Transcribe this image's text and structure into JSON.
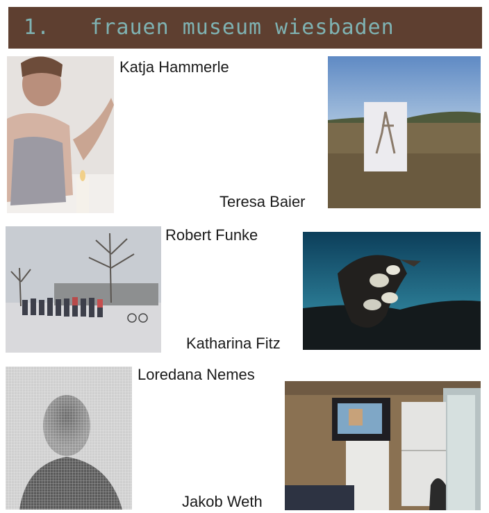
{
  "header": {
    "number": "1.",
    "title": "frauen museum wiesbaden",
    "color": "#5e3f30",
    "text_color": "#7fb3b3"
  },
  "artists": [
    {
      "name": "Katja Hammerle"
    },
    {
      "name": "Teresa Baier"
    },
    {
      "name": "Robert Funke"
    },
    {
      "name": "Katharina Fitz"
    },
    {
      "name": "Loredana Nemes"
    },
    {
      "name": "Jakob Weth"
    }
  ]
}
